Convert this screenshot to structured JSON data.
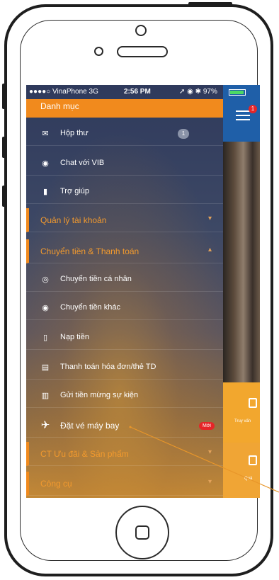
{
  "status_bar": {
    "carrier": "●●●●○ VinaPhone  3G",
    "time": "2:56 PM",
    "indicators": "➚ ◉ ✱ 97%"
  },
  "menu": {
    "header": "Danh mục",
    "top_items": [
      {
        "label": "Hộp thư",
        "icon": "mail-icon",
        "badge": "1"
      },
      {
        "label": "Chat với VIB",
        "icon": "chat-icon"
      },
      {
        "label": "Trợ giúp",
        "icon": "help-icon"
      }
    ],
    "sections": {
      "account": "Quản lý tài khoản",
      "transfer": "Chuyển tiền & Thanh toán",
      "promo": "CT Ưu đãi & Sản phẩm",
      "tools": "Công cụ"
    },
    "transfer_items": [
      {
        "label": "Chuyển tiền cá nhân",
        "icon": "transfer-person-icon"
      },
      {
        "label": "Chuyển tiền khác",
        "icon": "transfer-other-icon"
      },
      {
        "label": "Nạp tiền",
        "icon": "topup-icon"
      },
      {
        "label": "Thanh toán hóa đơn/thẻ TD",
        "icon": "bill-icon"
      },
      {
        "label": "Gửi tiền mừng sự kiện",
        "icon": "gift-money-icon"
      },
      {
        "label": "Đặt vé máy bay",
        "icon": "airplane-icon",
        "tag": "Mới"
      }
    ]
  },
  "right_panel": {
    "notification_count": "1",
    "tile1": "Truy vấn",
    "tile2": "Quả"
  },
  "colors": {
    "orange": "#f18a1d",
    "blue": "#1f5fa8",
    "red": "#e52528"
  }
}
